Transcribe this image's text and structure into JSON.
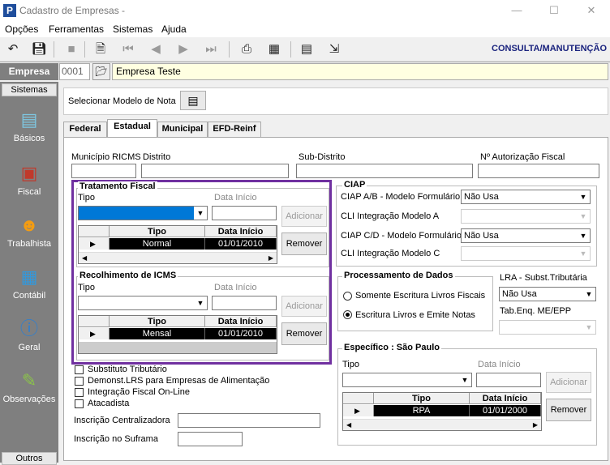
{
  "window": {
    "title": "Cadastro de Empresas -",
    "min_icon": "minimize-icon",
    "max_icon": "maximize-icon",
    "close_icon": "close-icon"
  },
  "menu": [
    "Opções",
    "Ferramentas",
    "Sistemas",
    "Ajuda"
  ],
  "toolbar": {
    "mode": "CONSULTA/MANUTENÇÃO"
  },
  "empresa": {
    "label": "Empresa",
    "code": "0001",
    "name": "Empresa Teste"
  },
  "sidebar": {
    "header": "Sistemas",
    "items": [
      {
        "label": "Básicos",
        "icon": "basicos-icon"
      },
      {
        "label": "Fiscal",
        "icon": "fiscal-icon"
      },
      {
        "label": "Trabalhista",
        "icon": "trabalhista-icon"
      },
      {
        "label": "Contábil",
        "icon": "contabil-icon"
      },
      {
        "label": "Geral",
        "icon": "geral-icon"
      },
      {
        "label": "Observações",
        "icon": "observacoes-icon"
      }
    ],
    "footer": "Outros"
  },
  "model": {
    "label": "Selecionar Modelo de Nota"
  },
  "tabs": [
    "Federal",
    "Estadual",
    "Municipal",
    "EFD-Reinf"
  ],
  "fields": {
    "municipio": "Município RICMS",
    "distrito": "Distrito",
    "subdistrito": "Sub-Distrito",
    "autorizacao": "Nº Autorização Fiscal"
  },
  "tratamento": {
    "title": "Tratamento Fiscal",
    "tipo_label": "Tipo",
    "data_label": "Data Início",
    "add": "Adicionar",
    "remove": "Remover",
    "col_tipo": "Tipo",
    "col_data": "Data Início",
    "row": {
      "tipo": "Normal",
      "data": "01/01/2010"
    }
  },
  "recolhimento": {
    "title": "Recolhimento de ICMS",
    "tipo_label": "Tipo",
    "data_label": "Data Início",
    "add": "Adicionar",
    "remove": "Remover",
    "col_tipo": "Tipo",
    "col_data": "Data Início",
    "row": {
      "tipo": "Mensal",
      "data": "01/01/2010"
    }
  },
  "ciap": {
    "title": "CIAP",
    "ab_label": "CIAP A/B - Modelo Formulário",
    "ab_value": "Não Usa",
    "cli_a": "CLI Integração Modelo A",
    "cd_label": "CIAP C/D - Modelo Formulário",
    "cd_value": "Não Usa",
    "cli_c": "CLI Integração Modelo C"
  },
  "processamento": {
    "title": "Processamento de Dados",
    "opt1": "Somente Escritura Livros Fiscais",
    "opt2": "Escritura Livros e Emite Notas",
    "selected": 2
  },
  "lra": {
    "label": "LRA - Subst.Tributária",
    "value": "Não Usa",
    "tab_label": "Tab.Enq. ME/EPP"
  },
  "checks": [
    "Substituto Tributário",
    "Demonst.LRS para Empresas de Alimentação",
    "Integração Fiscal On-Line",
    "Atacadista"
  ],
  "inscricao": {
    "centralizadora": "Inscrição Centralizadora",
    "suframa": "Inscrição no Suframa"
  },
  "especifico": {
    "title": "Específico : São Paulo",
    "tipo_label": "Tipo",
    "data_label": "Data Início",
    "add": "Adicionar",
    "remove": "Remover",
    "col_tipo": "Tipo",
    "col_data": "Data Início",
    "row": {
      "tipo": "RPA",
      "data": "01/01/2000"
    }
  }
}
